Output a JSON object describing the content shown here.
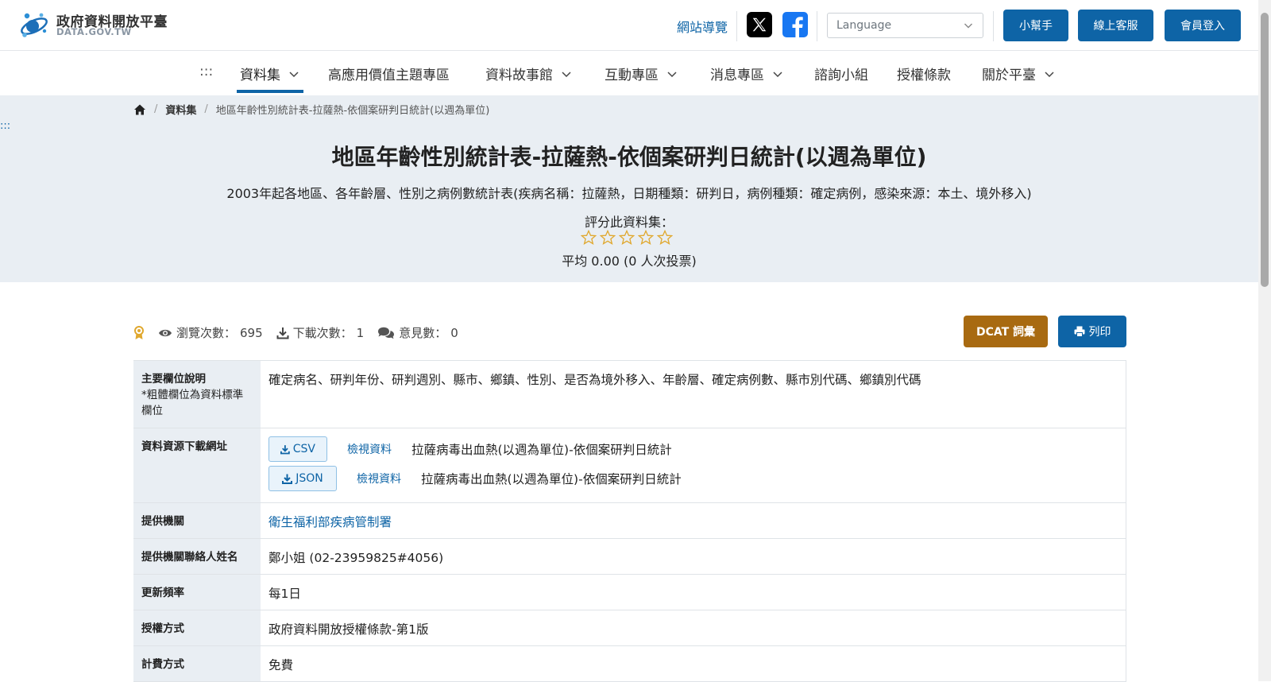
{
  "header": {
    "logo_title": "政府資料開放平臺",
    "logo_sub": "DATA.GOV.TW",
    "sitemap": "網站導覽",
    "language_placeholder": "Language",
    "buttons": [
      "小幫手",
      "線上客服",
      "會員登入"
    ]
  },
  "nav": {
    "menu_dots": ":::",
    "items": [
      {
        "label": "資料集",
        "dropdown": true,
        "active": true
      },
      {
        "label": "高應用價值主題專區",
        "dropdown": false
      },
      {
        "label": "資料故事館",
        "dropdown": true
      },
      {
        "label": "互動專區",
        "dropdown": true
      },
      {
        "label": "消息專區",
        "dropdown": true
      },
      {
        "label": "諮詢小組",
        "dropdown": false
      },
      {
        "label": "授權條款",
        "dropdown": false
      },
      {
        "label": "關於平臺",
        "dropdown": true
      }
    ]
  },
  "breadcrumb": {
    "section": "資料集",
    "current": "地區年齡性別統計表-拉薩熱-依個案研判日統計(以週為單位)"
  },
  "side_dots": ":::",
  "dataset": {
    "title": "地區年齡性別統計表-拉薩熱-依個案研判日統計(以週為單位)",
    "description": "2003年起各地區、各年齡層、性別之病例數統計表(疾病名稱：拉薩熱，日期種類：研判日，病例種類：確定病例，感染來源：本土、境外移入)",
    "rate_label": "評分此資料集：",
    "stars": 5,
    "rating": 0,
    "average": "平均 0.00 (0 人次投票)"
  },
  "stats": {
    "views_label": "瀏覽次數：",
    "views": "695",
    "downloads_label": "下載次數：",
    "downloads": "1",
    "comments_label": "意見數：",
    "comments": "0"
  },
  "actions": {
    "dcat": "DCAT 詞彙",
    "print": "列印"
  },
  "table": {
    "fields_label": "主要欄位說明",
    "fields_note": "*粗體欄位為資料標準欄位",
    "fields_value": "確定病名、研判年份、研判週別、縣市、鄉鎮、性別、是否為境外移入、年齡層、確定病例數、縣市別代碼、鄉鎮別代碼",
    "resources_label": "資料資源下載網址",
    "resources": [
      {
        "format": "CSV",
        "view": "檢視資料",
        "name": "拉薩病毒出血熱(以週為單位)-依個案研判日統計"
      },
      {
        "format": "JSON",
        "view": "檢視資料",
        "name": "拉薩病毒出血熱(以週為單位)-依個案研判日統計"
      }
    ],
    "provider_label": "提供機關",
    "provider_value": "衛生福利部疾病管制署",
    "contact_label": "提供機關聯絡人姓名",
    "contact_value": "鄭小姐 (02-23959825#4056)",
    "frequency_label": "更新頻率",
    "frequency_value": "每1日",
    "license_label": "授權方式",
    "license_value": "政府資料開放授權條款-第1版",
    "fee_label": "計費方式",
    "fee_value": "免費"
  },
  "colors": {
    "primary": "#0e64a6",
    "dcat": "#a86a11",
    "hero_bg": "#e9eef3",
    "star": "#e0a82e"
  }
}
